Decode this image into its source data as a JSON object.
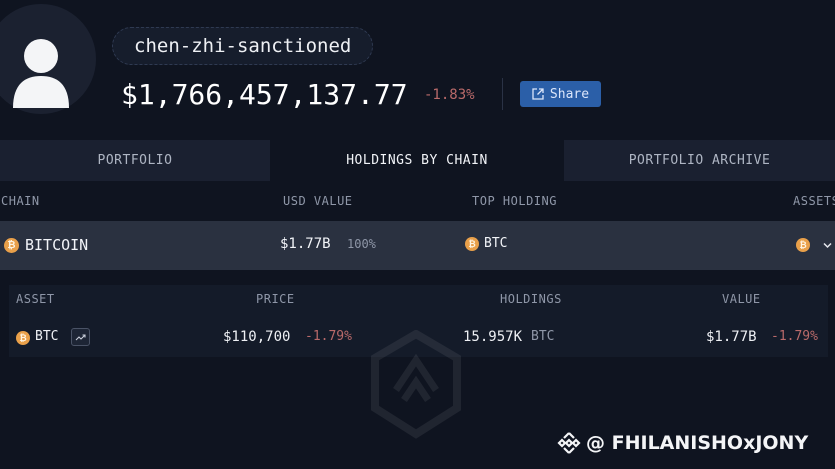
{
  "profile": {
    "name": "chen-zhi-sanctioned",
    "total_value": "$1,766,457,137.77",
    "total_change": "-1.83%",
    "share_label": "Share"
  },
  "tabs": [
    {
      "label": "PORTFOLIO",
      "active": false
    },
    {
      "label": "HOLDINGS BY CHAIN",
      "active": true
    },
    {
      "label": "PORTFOLIO ARCHIVE",
      "active": false
    }
  ],
  "chain_table": {
    "headers": {
      "chain": "CHAIN",
      "usd_value": "USD VALUE",
      "top_holding": "TOP HOLDING",
      "assets": "ASSETS"
    },
    "rows": [
      {
        "chain": "BITCOIN",
        "usd_value": "$1.77B",
        "share": "100%",
        "top_holding": "BTC"
      }
    ]
  },
  "asset_table": {
    "headers": {
      "asset": "ASSET",
      "price": "PRICE",
      "holdings": "HOLDINGS",
      "value": "VALUE"
    },
    "rows": [
      {
        "asset": "BTC",
        "price": "$110,700",
        "price_change": "-1.79%",
        "holdings": "15.957K",
        "holdings_unit": "BTC",
        "value": "$1.77B",
        "value_change": "-1.79%"
      }
    ]
  },
  "watermark": {
    "text": "@ FHILANISHOxJONY"
  },
  "icons": {
    "avatar": "user-avatar-icon",
    "share": "external-link-icon",
    "coin": "bitcoin-icon",
    "chart": "trend-chart-icon",
    "expand": "chevron-down-icon",
    "brand": "binance-icon"
  },
  "colors": {
    "background": "#0f1420",
    "negative": "#b96a6a",
    "share_button": "#2b5fa8",
    "bitcoin": "#e9a04a",
    "selected_row": "#2a3140"
  }
}
